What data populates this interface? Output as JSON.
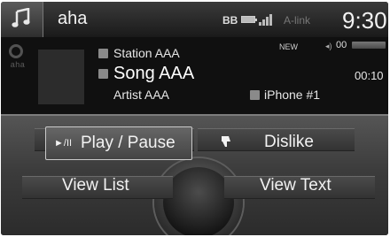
{
  "header": {
    "app_icon": "music-note-icon",
    "app_name": "aha",
    "bluetooth_indicator": "BB",
    "network_name": "A-link",
    "clock": "9:30"
  },
  "now_playing": {
    "station": "Station AAA",
    "song": "Song AAA",
    "artist": "Artist AAA",
    "source": "iPhone #1",
    "new_label": "NEW",
    "volume_label": "00",
    "elapsed_time": "00:10",
    "icons": {
      "station": "station-icon",
      "song": "song-icon",
      "source": "phone-icon"
    }
  },
  "controls": {
    "play_pause_glyph": "►/II",
    "play_pause": "Play / Pause",
    "dislike": "Dislike",
    "view_list": "View List",
    "view_text": "View Text"
  },
  "colors": {
    "background": "#0d0d0d",
    "panel": "#3c3c3c",
    "text": "#f2f2f2",
    "highlight_border": "#c9c9c9"
  }
}
